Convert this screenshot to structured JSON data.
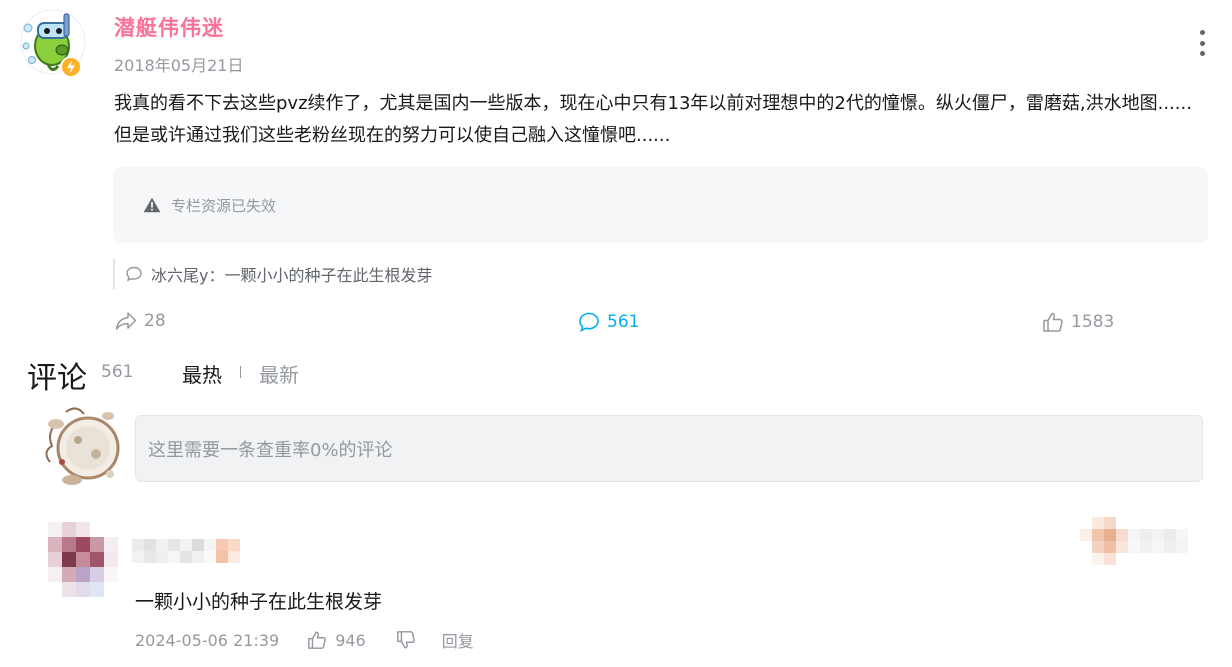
{
  "post": {
    "author": "潜艇伟伟迷",
    "date": "2018年05月21日",
    "text": "我真的看不下去这些pvz续作了，尤其是国内一些版本，现在心中只有13年以前对理想中的2代的憧憬。纵火僵尸，雷磨菇,洪水地图......但是或许通过我们这些老粉丝现在的努力可以使自己融入这憧憬吧......",
    "invalid_notice": "专栏资源已失效",
    "top_reply_preview": "冰六尾y：一颗小小的种子在此生根发芽",
    "stats": {
      "forward": "28",
      "comment": "561",
      "like": "1583"
    }
  },
  "comments": {
    "title": "评论",
    "count": "561",
    "sort_hot": "最热",
    "sort_new": "最新",
    "input_placeholder": "这里需要一条查重率0%的评论"
  },
  "reply": {
    "text": "一颗小小的种子在此生根发芽",
    "time": "2024-05-06 21:39",
    "likes": "946",
    "reply_label": "回复"
  },
  "colors": {
    "accent": "#00aeec",
    "author_pink": "#fb7299",
    "muted": "#9499a0"
  },
  "icons": [
    "pea-avatar-icon",
    "lightning-badge-icon",
    "more-icon",
    "warning-icon",
    "comment-bubble-icon",
    "forward-icon",
    "like-icon",
    "dislike-icon"
  ]
}
